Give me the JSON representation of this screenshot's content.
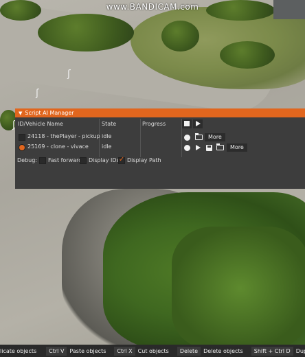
{
  "watermark": "www.BANDICAM.com",
  "window": {
    "title": "Script AI Manager",
    "columns": {
      "id": "ID/Vehicle Name",
      "state": "State",
      "progress": "Progress"
    },
    "header_controls": [
      "stop-icon",
      "play-icon"
    ],
    "rows": [
      {
        "name": "24118 - thePlayer - pickup",
        "state": "idle",
        "selected": false,
        "controls": [
          "record-icon",
          "folder-icon"
        ],
        "more_label": "More"
      },
      {
        "name": "25169 - clone - vivace",
        "state": "idle",
        "selected": true,
        "controls": [
          "record-icon",
          "play-icon",
          "save-icon",
          "folder-icon"
        ],
        "more_label": "More"
      }
    ],
    "debug": {
      "label": "Debug:",
      "fast_forward": {
        "label": "Fast forward",
        "checked": false
      },
      "display_ids": {
        "label": "Display IDs",
        "checked": false
      },
      "display_path": {
        "label": "Display Path",
        "checked": true
      }
    }
  },
  "shortcuts": [
    {
      "label": "licate objects"
    },
    {
      "key": "Ctrl V",
      "label": "Paste objects"
    },
    {
      "key": "Ctrl X",
      "label": "Cut objects"
    },
    {
      "key": "Delete",
      "label": "Delete objects"
    },
    {
      "key": "Shift + Ctrl D",
      "label": "Duplicate at cam pos"
    }
  ],
  "colors": {
    "accent": "#e1661e",
    "panel": "#3d3d3d",
    "check": "#e1661e"
  }
}
